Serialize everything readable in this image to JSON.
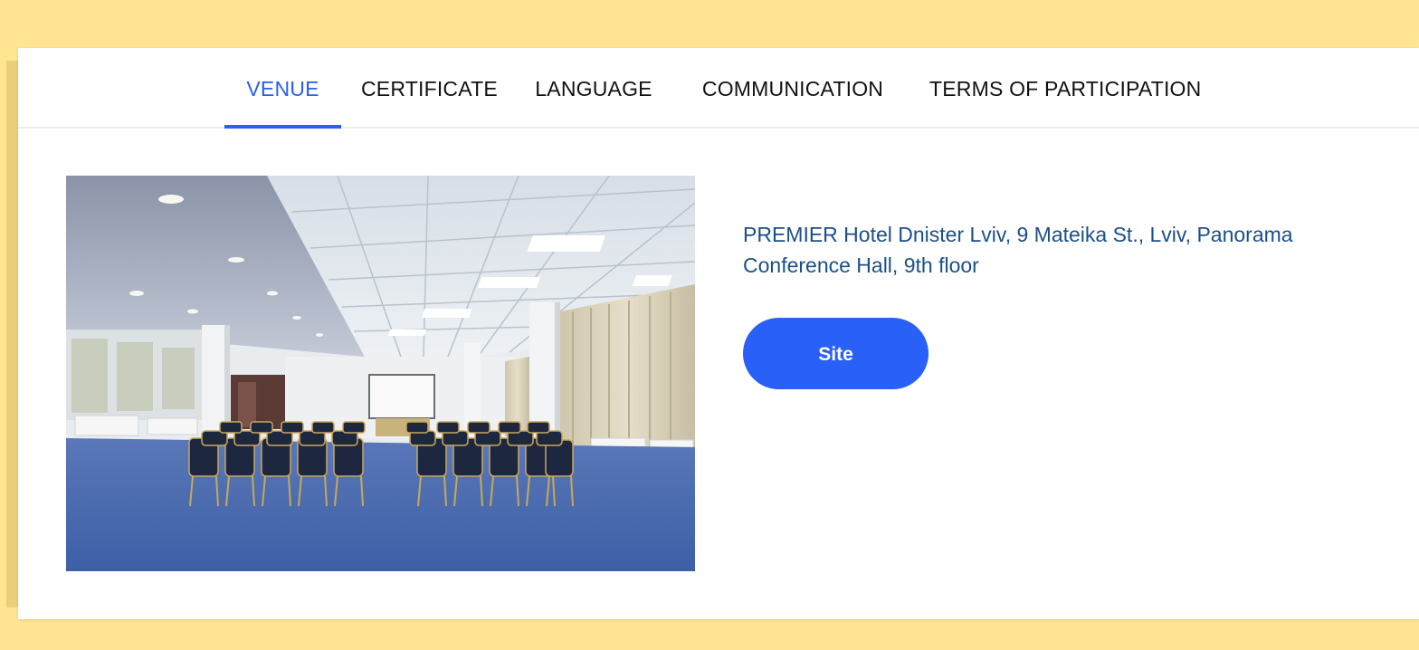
{
  "tabs": [
    {
      "label": "VENUE",
      "active": true
    },
    {
      "label": "CERTIFICATE",
      "active": false
    },
    {
      "label": "LANGUAGE",
      "active": false
    },
    {
      "label": "COMMUNICATION",
      "active": false
    },
    {
      "label": "TERMS OF PARTICIPATION",
      "active": false
    }
  ],
  "venue": {
    "address": "PREMIER Hotel Dnister Lviv, 9 Mateika St., Lviv, Panorama Conference Hall, 9th floor",
    "site_button_label": "Site"
  },
  "colors": {
    "page_background": "#FFE592",
    "accent": "#2A60F0",
    "address_text": "#1B4F8A",
    "button": "#2860F8"
  }
}
